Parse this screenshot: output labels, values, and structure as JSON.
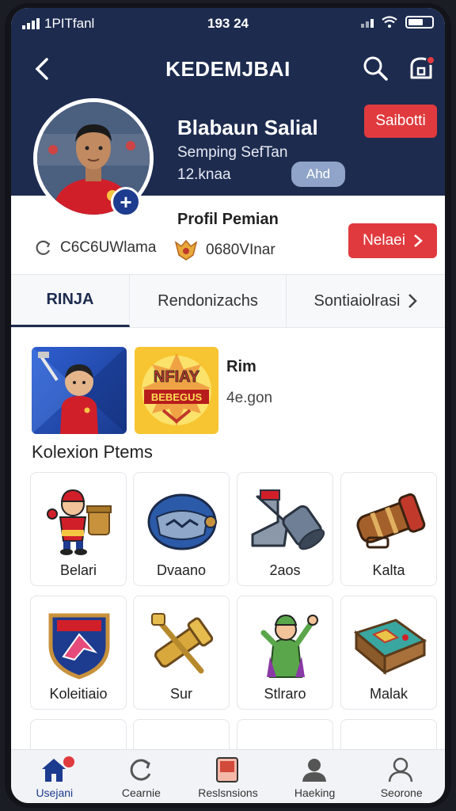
{
  "status": {
    "carrier": "1PITfanl",
    "time": "193 24"
  },
  "header": {
    "title": "KEDEMJBAI"
  },
  "profile": {
    "name": "Blabaun Salial",
    "subtitle": "Semping SefTan",
    "count": "12.knaa",
    "add_label": "Ahd",
    "subscribe_label": "Saibotti",
    "label": "Profil Pemian",
    "stats": [
      "C6C6UWlama",
      "0680VInar"
    ],
    "next_label": "Nelaei"
  },
  "tabs": [
    "RINJA",
    "Rendonizachs",
    "Sontiaiolrasi"
  ],
  "featured": {
    "title": "Rim",
    "subtitle": "4e.gon",
    "badge_text": "NFIAY",
    "badge_sub": "BEBEGUS"
  },
  "collection": {
    "title": "Kolexion Ptems",
    "items": [
      "Belari",
      "Dvaano",
      "2aos",
      "Kalta",
      "Koleitiaio",
      "Sur",
      "Stlraro",
      "Malak"
    ]
  },
  "bottom_nav": [
    "Usejani",
    "Cearnie",
    "Reslsnsions",
    "Haeking",
    "Seorone"
  ],
  "colors": {
    "primary": "#1d2b4f",
    "accent": "#e03a3e"
  }
}
